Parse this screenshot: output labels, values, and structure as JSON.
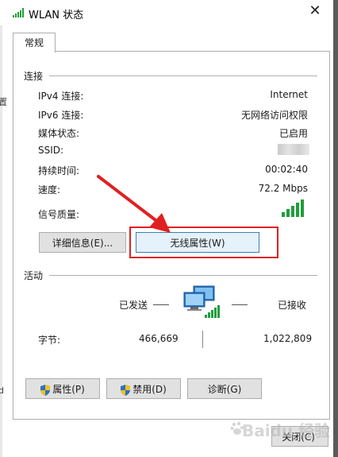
{
  "window": {
    "title": "WLAN 状态"
  },
  "tabs": [
    {
      "label": "常规"
    }
  ],
  "connection": {
    "group_label": "连接",
    "rows": [
      {
        "label": "IPv4 连接:",
        "value": "Internet"
      },
      {
        "label": "IPv6 连接:",
        "value": "无网络访问权限"
      },
      {
        "label": "媒体状态:",
        "value": "已启用"
      },
      {
        "label": "SSID:",
        "value": ""
      },
      {
        "label": "持续时间:",
        "value": "00:02:40"
      },
      {
        "label": "速度:",
        "value": "72.2 Mbps"
      },
      {
        "label": "信号质量:",
        "value": ""
      }
    ],
    "signal_level": "5/5",
    "details_button": "详细信息(E)...",
    "wireless_props_button": "无线属性(W)"
  },
  "activity": {
    "group_label": "活动",
    "sent_label": "已发送",
    "received_label": "已接收",
    "bytes_label": "字节:",
    "bytes_sent": "466,669",
    "bytes_received": "1,022,809"
  },
  "buttons": {
    "properties": "属性(P)",
    "disable": "禁用(D)",
    "diagnose": "诊断(G)"
  },
  "footer": {
    "close": "关闭(C)",
    "watermark": "Baidu 经验"
  },
  "background_fragments": {
    "left_top": "置",
    "left_bottom": "d"
  },
  "colors": {
    "annotation_red": "#e02020",
    "focus_blue": "#3c7fb1",
    "signal_green": "#1f9e3a"
  },
  "icons": [
    "wifi-signal-icon",
    "close-icon",
    "network-computers-icon",
    "shield-icon",
    "red-arrow-annotation"
  ]
}
